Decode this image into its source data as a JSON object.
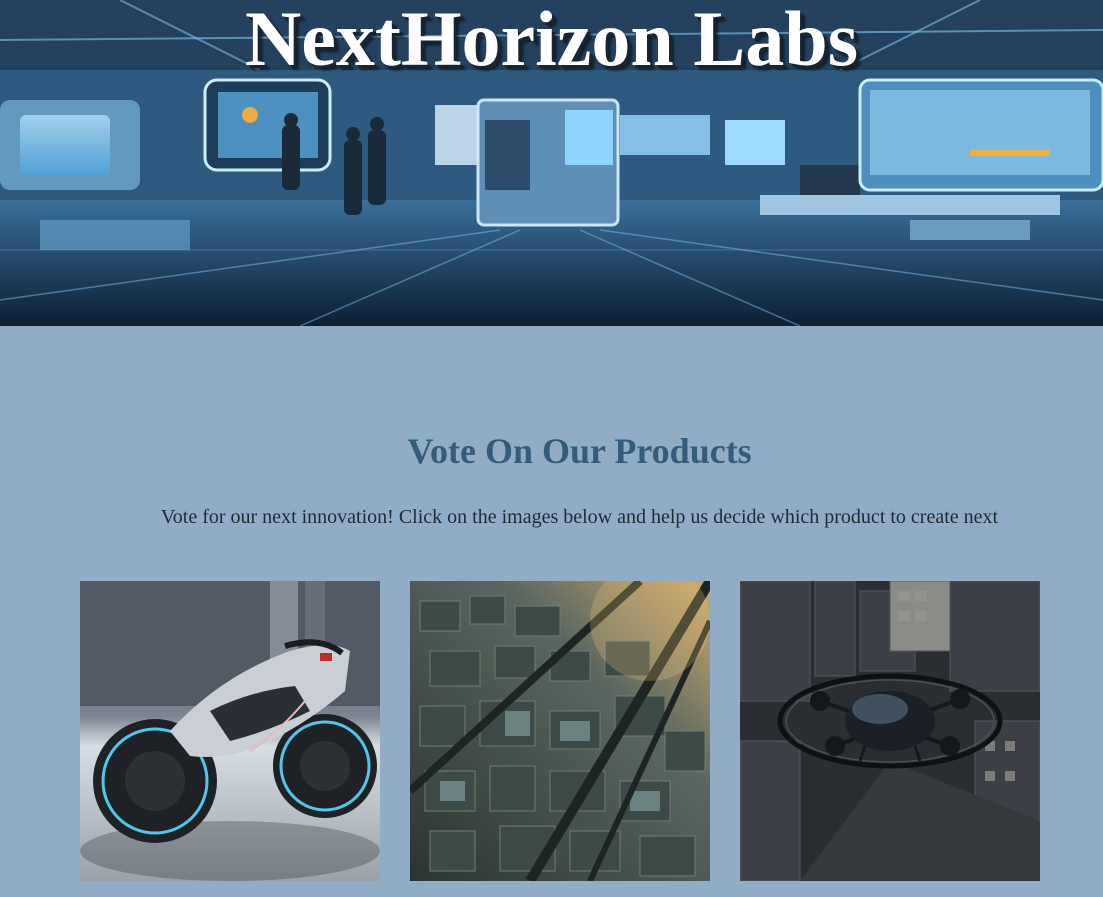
{
  "header": {
    "title": "NextHorizon Labs",
    "banner_image": "futuristic-lab-banner"
  },
  "main": {
    "heading": "Vote On Our Products",
    "intro": "Vote for our next innovation! Click on the images below and help us decide which product to create next"
  },
  "products": [
    {
      "image": "futuristic-motorcycle-image"
    },
    {
      "image": "aerial-smart-city-image"
    },
    {
      "image": "flying-drone-car-image"
    }
  ],
  "colors": {
    "page_background": "#91adc5",
    "heading": "#345d7d",
    "body_text": "#1f2a33",
    "title_text": "#ffffff"
  }
}
